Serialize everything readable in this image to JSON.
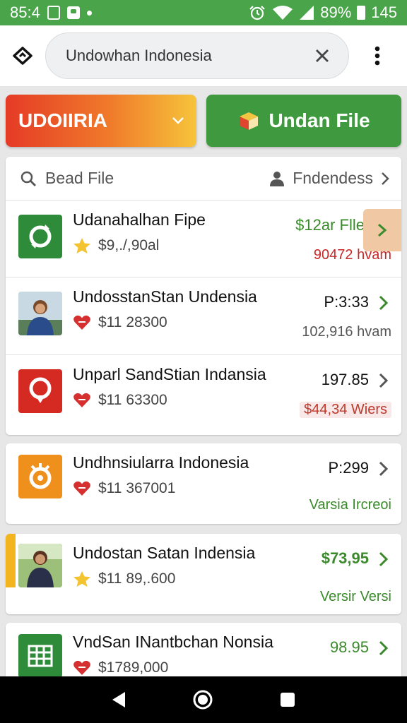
{
  "status_bar": {
    "time": "85:4",
    "battery": "89%",
    "clock_right": "145",
    "icons": [
      "screenshot-icon",
      "image-icon",
      "dot-icon",
      "alarm-icon",
      "wifi-icon",
      "signal-icon",
      "battery-icon"
    ]
  },
  "search": {
    "query": "Undowhan Indonesia",
    "icons": [
      "home-icon",
      "clear-icon",
      "more-icon"
    ]
  },
  "buttons": {
    "dropdown_label": "UDOIIRIA",
    "upload_label": "Undan File"
  },
  "filter": {
    "left_label": "Bead File",
    "right_label": "Fndendess"
  },
  "list": [
    {
      "title": "Udanahalhan Fipe",
      "price": "$9,./,90al",
      "value": "$12ar Flle",
      "meta": "90472 hvam",
      "badge": "star",
      "thumb": "green-sync",
      "value_color": "#3a8a2b",
      "meta_color": "#c62828"
    },
    {
      "title": "UndosstanStan Undensia",
      "price": "$11 28300",
      "value": "P:3:33",
      "meta": "102,916 hvam",
      "badge": "heart",
      "thumb": "photo-woman-1",
      "value_color": "#111111",
      "meta_color": "#555555"
    },
    {
      "title": "Unparl SandStian Indansia",
      "price": "$11 63300",
      "value": "197.85",
      "meta": "$44,34 Wiers",
      "badge": "heart",
      "thumb": "red-pin",
      "value_color": "#111111",
      "meta_color": "#c0392b"
    },
    {
      "title": "Undhnsiularra Indonesia",
      "price": "$11 367001",
      "value": "P:299",
      "meta": "Varsia Ircreoi",
      "badge": "heart",
      "thumb": "orange-target",
      "value_color": "#111111",
      "meta_color": "#3a8a2b"
    },
    {
      "title": "Undostan Satan Indensia",
      "price": "$11 89,.600",
      "value": "$73,95",
      "meta": "Versir Versi",
      "badge": "star",
      "thumb": "photo-woman-2",
      "value_color": "#3a8a2b",
      "meta_color": "#3a8a2b"
    },
    {
      "title": "VndSan INantbchan Nonsia",
      "price": "$1789,000",
      "value": "98.95",
      "meta": "",
      "badge": "heart",
      "thumb": "green-sheet",
      "value_color": "#3a8a2b",
      "meta_color": "#3a8a2b"
    }
  ],
  "nav": [
    "back-icon",
    "home-circle-icon",
    "recents-icon"
  ]
}
